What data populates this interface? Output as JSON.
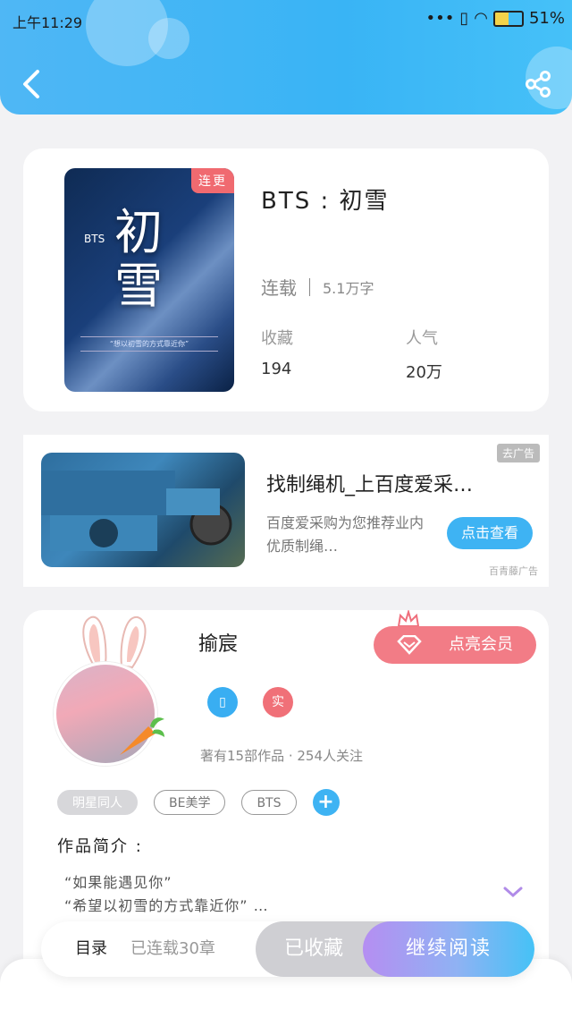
{
  "status_bar": {
    "time": "上午11:29",
    "battery": "51%"
  },
  "book": {
    "tag": "连更",
    "title": "BTS : 初雪",
    "status": "连载",
    "words": "5.1万字",
    "collect_label": "收藏",
    "collect_value": "194",
    "popularity_label": "人气",
    "popularity_value": "20万",
    "cover_title": "初雪",
    "cover_series": "BTS",
    "cover_slogan": "“想以初雪的方式靠近你”"
  },
  "ad": {
    "close_label": "去广告",
    "title": "找制绳机_上百度爱采…",
    "desc": "百度爱采购为您推荐业内优质制绳…",
    "button": "点击查看",
    "source": "百青藤广告"
  },
  "author": {
    "name": "揄宸",
    "vip_button": "点亮会员",
    "badge_real": "实",
    "works_info": "著有15部作品 · 254人关注",
    "tags": [
      "明星同人",
      "BE美学",
      "BTS"
    ]
  },
  "intro": {
    "label": "作品简介 :",
    "line1": "“如果能遇见你”",
    "line2": "“希望以初雪的方式靠近你” …"
  },
  "actions": {
    "toc": "目录",
    "chapters": "已连载30章",
    "collected": "已收藏",
    "continue": "继续阅读"
  }
}
